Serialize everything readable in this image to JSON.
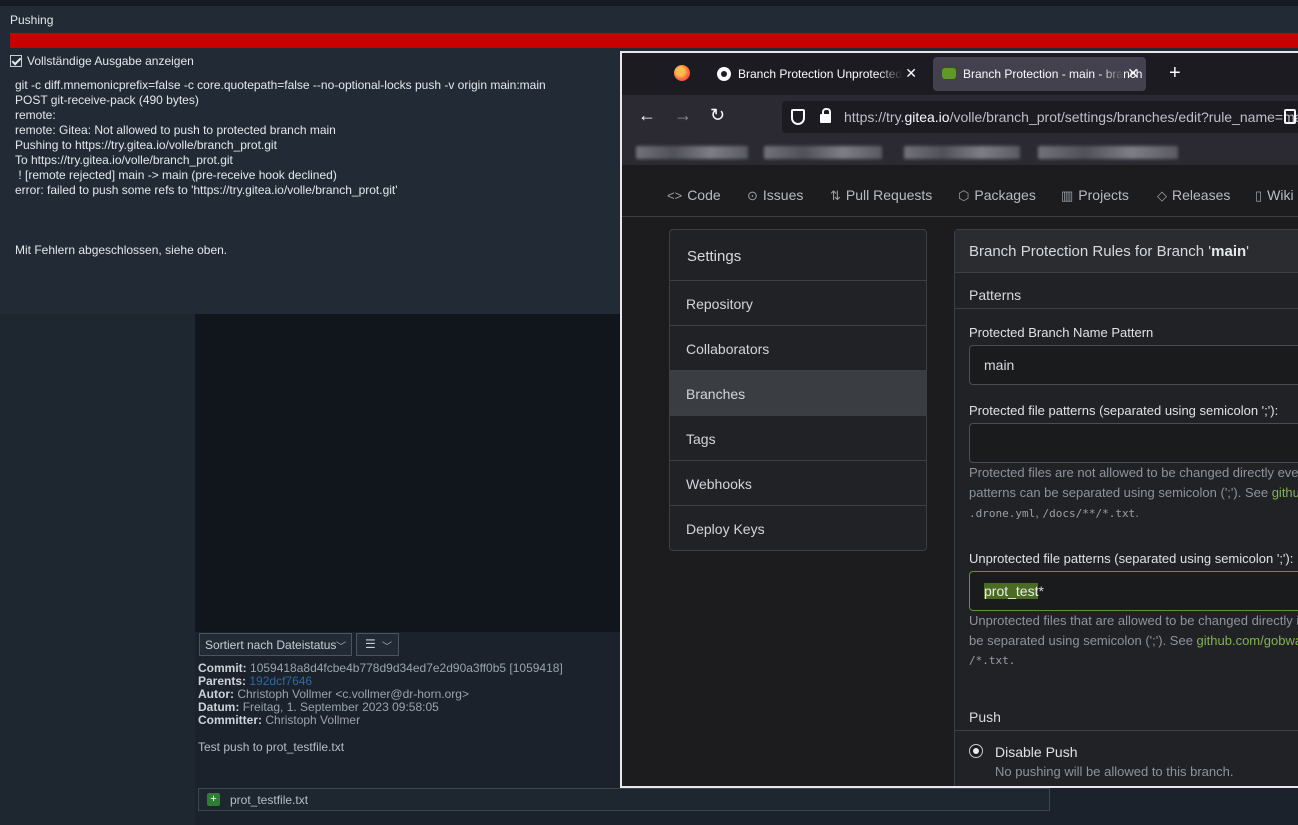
{
  "dialog": {
    "title": "Pushing",
    "checkbox_label": "Vollständige Ausgabe anzeigen",
    "output_lines": [
      "git -c diff.mnemonicprefix=false -c core.quotepath=false --no-optional-locks push -v origin main:main",
      "POST git-receive-pack (490 bytes)",
      "remote:",
      "remote: Gitea: Not allowed to push to protected branch main",
      "Pushing to https://try.gitea.io/volle/branch_prot.git",
      "To https://try.gitea.io/volle/branch_prot.git",
      " ! [remote rejected] main -> main (pre-receive hook declined)",
      "error: failed to push some refs to 'https://try.gitea.io/volle/branch_prot.git'"
    ],
    "result": "Mit Fehlern abgeschlossen, siehe oben.",
    "progress_color": "#c80000"
  },
  "client": {
    "sort_label": "Sortiert nach Dateistatus",
    "view_icon": "list-icon",
    "commit": {
      "commit_label": "Commit:",
      "commit_value": "1059418a8d4fcbe4b778d9d34ed7e2d90a3ff0b5 [1059418]",
      "parents_label": "Parents:",
      "parents_value": "192dcf7646",
      "author_label": "Autor:",
      "author_value": "Christoph Vollmer <c.vollmer@dr-horn.org>",
      "date_label": "Datum:",
      "date_value": "Freitag, 1. September 2023 09:58:05",
      "committer_label": "Committer:",
      "committer_value": "Christoph Vollmer"
    },
    "message": "Test push to prot_testfile.txt",
    "file": "prot_testfile.txt"
  },
  "browser": {
    "tabs": [
      {
        "title": "Branch Protection Unprotected",
        "icon": "github-icon"
      },
      {
        "title": "Branch Protection - main - branch",
        "icon": "gitea-icon"
      }
    ],
    "url_prefix": "https://try.",
    "url_host": "gitea.io",
    "url_path": "/volle/branch_prot/settings/branches/edit?rule_name=main"
  },
  "repo_nav": [
    {
      "label": "Code",
      "icon": "code-icon",
      "glyph": "<>"
    },
    {
      "label": "Issues",
      "icon": "issue-icon",
      "glyph": "⊙"
    },
    {
      "label": "Pull Requests",
      "icon": "pull-request-icon",
      "glyph": "⇅"
    },
    {
      "label": "Packages",
      "icon": "package-icon",
      "glyph": "⬡"
    },
    {
      "label": "Projects",
      "icon": "project-icon",
      "glyph": "▥"
    },
    {
      "label": "Releases",
      "icon": "tag-icon",
      "glyph": "◇"
    },
    {
      "label": "Wiki",
      "icon": "book-icon",
      "glyph": "▯"
    }
  ],
  "settings_menu": {
    "title": "Settings",
    "items": [
      "Repository",
      "Collaborators",
      "Branches",
      "Tags",
      "Webhooks",
      "Deploy Keys"
    ],
    "active": "Branches"
  },
  "protection": {
    "header_prefix": "Branch Protection Rules for Branch '",
    "branch": "main",
    "header_suffix": "'",
    "patterns_title": "Patterns",
    "name_pattern_label": "Protected Branch Name Pattern",
    "name_pattern_value": "main",
    "protected_label": "Protected file patterns (separated using semicolon ';'):",
    "protected_value": "",
    "protected_help_1": "Protected files are not allowed to be changed directly even",
    "protected_help_2a": "patterns can be separated using semicolon (';'). See ",
    "protected_help_2_link": "github.com/gobwas/glob",
    "protected_help_3a": ".drone.yml",
    "protected_help_3b": ", ",
    "protected_help_3c": "/docs/**/*.txt",
    "protected_help_3d": ".",
    "unprotected_label": "Unprotected file patterns (separated using semicolon ';'):",
    "unprotected_value_hl": "prot_test",
    "unprotected_value_rest": "*",
    "unprotected_help_1": "Unprotected files that are allowed to be changed directly if",
    "unprotected_help_2a": "be separated using semicolon (';'). See ",
    "unprotected_help_2_link": "github.com/gobwas/glob",
    "unprotected_help_3": "/*.txt.",
    "push_title": "Push",
    "push_option_label": "Disable Push",
    "push_option_help": "No pushing will be allowed to this branch.",
    "accent": "#609926"
  }
}
